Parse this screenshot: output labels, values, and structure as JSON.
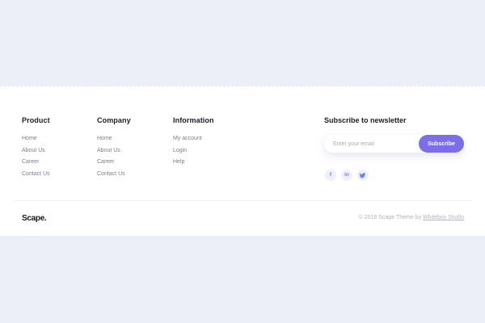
{
  "columns": [
    {
      "title": "Product",
      "links": [
        "Home",
        "About Us",
        "Career",
        "Contact Us"
      ]
    },
    {
      "title": "Company",
      "links": [
        "Home",
        "About Us",
        "Career",
        "Contact Us"
      ]
    },
    {
      "title": "Information",
      "links": [
        "My account",
        "Login",
        "Help"
      ]
    }
  ],
  "newsletter": {
    "title": "Subscribe to newsletter",
    "placeholder": "Enter your email",
    "button_label": "Subscribe"
  },
  "socials": [
    {
      "name": "facebook-icon",
      "glyph": "f"
    },
    {
      "name": "linkedin-icon",
      "glyph": "in"
    },
    {
      "name": "twitter-icon",
      "glyph": "𝕥"
    }
  ],
  "brand": {
    "logo_text": "Scape."
  },
  "copyright": {
    "prefix": "© 2018 Scape Theme by ",
    "link_text": "Whitebox Studio"
  },
  "colors": {
    "accent": "#7b6ee6",
    "page_bg": "#eceef8",
    "footer_bg": "#ffffff"
  }
}
